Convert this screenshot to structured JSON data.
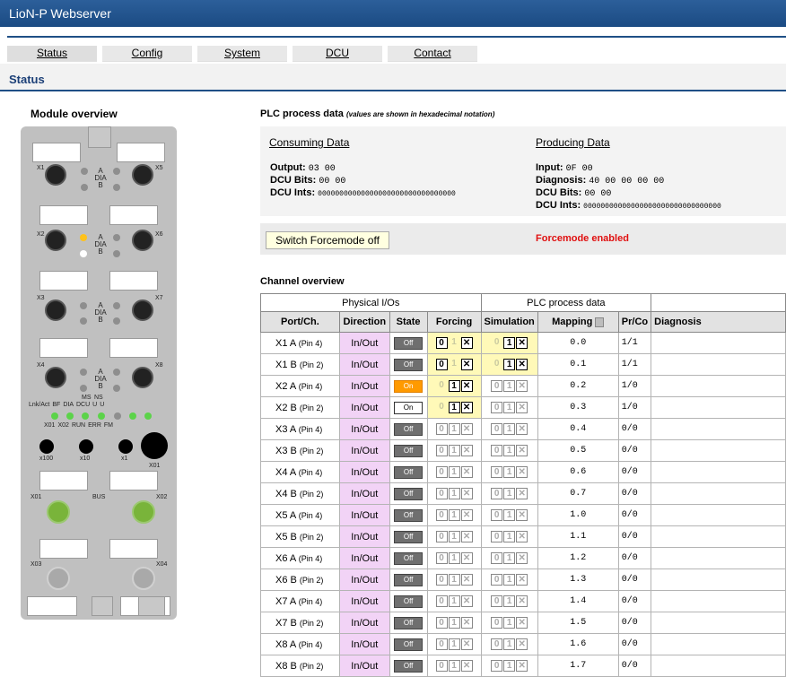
{
  "app": {
    "title": "LioN-P Webserver"
  },
  "nav": {
    "tabs": [
      {
        "label": "Status",
        "active": true
      },
      {
        "label": "Config"
      },
      {
        "label": "System"
      },
      {
        "label": "DCU"
      },
      {
        "label": "Contact"
      }
    ]
  },
  "section": {
    "title": "Status"
  },
  "module": {
    "title": "Module overview",
    "device": {
      "x1": "X1",
      "x2": "X2",
      "x3": "X3",
      "x4": "X4",
      "x5": "X5",
      "x6": "X6",
      "x7": "X7",
      "x8": "X8",
      "a": "A",
      "dia": "DIA",
      "b": "B",
      "bus_leds": [
        "Lnk/Act",
        "BF",
        "DIA",
        "DCU",
        "U",
        "U"
      ],
      "ms": "MS",
      "ns": "NS",
      "ports_row": [
        "X01",
        "X02",
        "RUN",
        "ERR",
        "FM"
      ],
      "rotary": [
        "x100",
        "x10",
        "x1"
      ],
      "x01": "X01",
      "x02": "X02",
      "x03": "X03",
      "x04": "X04",
      "bus": "BUS"
    }
  },
  "plc": {
    "title": "PLC process data",
    "note": "(values are shown in hexadecimal notation)",
    "consuming": {
      "heading": "Consuming Data",
      "output_label": "Output:",
      "output": "03 00",
      "dcu_bits_label": "DCU Bits:",
      "dcu_bits": "00 00",
      "dcu_ints_label": "DCU Ints:",
      "dcu_ints": "00000000000000000000000000000000"
    },
    "producing": {
      "heading": "Producing Data",
      "input_label": "Input:",
      "input": "0F 00",
      "diagnosis_label": "Diagnosis:",
      "diagnosis": "40 00 00 00 00",
      "dcu_bits_label": "DCU Bits:",
      "dcu_bits": "00 00",
      "dcu_ints_label": "DCU Ints:",
      "dcu_ints": "00000000000000000000000000000000"
    },
    "force_button": "Switch Forcemode off",
    "force_status": "Forcemode enabled"
  },
  "channels": {
    "title": "Channel overview",
    "group_headers": [
      "Physical I/Os",
      "PLC process data"
    ],
    "headers": [
      "Port/Ch.",
      "Direction",
      "State",
      "Forcing",
      "Simulation",
      "Mapping",
      "Pr/Co",
      "Diagnosis"
    ],
    "rows": [
      {
        "port": "X1 A",
        "pin": "(Pin 4)",
        "dir": "In/Out",
        "state": "Off",
        "force_active": true,
        "force_sel": "X",
        "sim_active": true,
        "mapping": "0.0",
        "prco": "1/1"
      },
      {
        "port": "X1 B",
        "pin": "(Pin 2)",
        "dir": "In/Out",
        "state": "Off",
        "force_active": true,
        "force_sel": "X",
        "sim_active": true,
        "mapping": "0.1",
        "prco": "1/1"
      },
      {
        "port": "X2 A",
        "pin": "(Pin 4)",
        "dir": "In/Out",
        "state": "On",
        "force_active": true,
        "force_sel": "1",
        "sim_active": false,
        "mapping": "0.2",
        "prco": "1/0"
      },
      {
        "port": "X2 B",
        "pin": "(Pin 2)",
        "dir": "In/Out",
        "state": "On",
        "force_active": true,
        "force_sel": "1",
        "sim_active": false,
        "mapping": "0.3",
        "prco": "1/0"
      },
      {
        "port": "X3 A",
        "pin": "(Pin 4)",
        "dir": "In/Out",
        "state": "Off",
        "mapping": "0.4",
        "prco": "0/0"
      },
      {
        "port": "X3 B",
        "pin": "(Pin 2)",
        "dir": "In/Out",
        "state": "Off",
        "mapping": "0.5",
        "prco": "0/0"
      },
      {
        "port": "X4 A",
        "pin": "(Pin 4)",
        "dir": "In/Out",
        "state": "Off",
        "mapping": "0.6",
        "prco": "0/0"
      },
      {
        "port": "X4 B",
        "pin": "(Pin 2)",
        "dir": "In/Out",
        "state": "Off",
        "mapping": "0.7",
        "prco": "0/0"
      },
      {
        "port": "X5 A",
        "pin": "(Pin 4)",
        "dir": "In/Out",
        "state": "Off",
        "mapping": "1.0",
        "prco": "0/0"
      },
      {
        "port": "X5 B",
        "pin": "(Pin 2)",
        "dir": "In/Out",
        "state": "Off",
        "mapping": "1.1",
        "prco": "0/0"
      },
      {
        "port": "X6 A",
        "pin": "(Pin 4)",
        "dir": "In/Out",
        "state": "Off",
        "mapping": "1.2",
        "prco": "0/0"
      },
      {
        "port": "X6 B",
        "pin": "(Pin 2)",
        "dir": "In/Out",
        "state": "Off",
        "mapping": "1.3",
        "prco": "0/0"
      },
      {
        "port": "X7 A",
        "pin": "(Pin 4)",
        "dir": "In/Out",
        "state": "Off",
        "mapping": "1.4",
        "prco": "0/0"
      },
      {
        "port": "X7 B",
        "pin": "(Pin 2)",
        "dir": "In/Out",
        "state": "Off",
        "mapping": "1.5",
        "prco": "0/0"
      },
      {
        "port": "X8 A",
        "pin": "(Pin 4)",
        "dir": "In/Out",
        "state": "Off",
        "mapping": "1.6",
        "prco": "0/0"
      },
      {
        "port": "X8 B",
        "pin": "(Pin 2)",
        "dir": "In/Out",
        "state": "Off",
        "mapping": "1.7",
        "prco": "0/0"
      }
    ]
  },
  "colors": {
    "header_blue": "#1f4f86",
    "direction_bg": "#f2d3f6",
    "state_on": "#ff9a00",
    "force_status": "#e01010"
  }
}
